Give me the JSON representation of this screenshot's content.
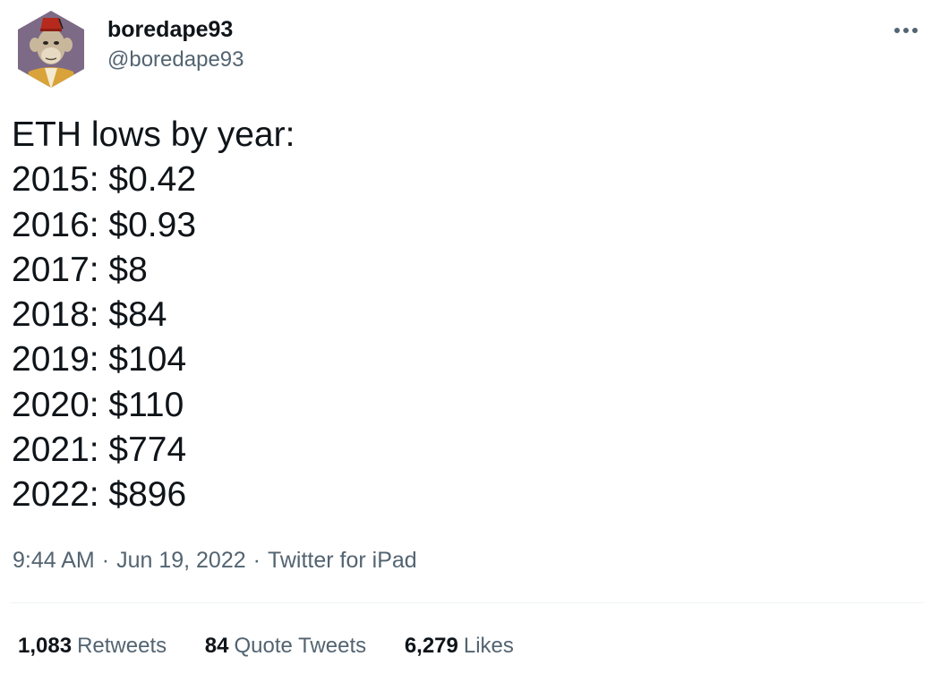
{
  "author": {
    "display_name": "boredape93",
    "handle": "@boredape93"
  },
  "tweet": {
    "lines": [
      "ETH lows by year:",
      "2015: $0.42",
      "2016: $0.93",
      "2017: $8",
      "2018: $84",
      "2019: $104",
      "2020: $110",
      "2021: $774",
      "2022: $896"
    ]
  },
  "meta": {
    "time": "9:44 AM",
    "date": "Jun 19, 2022",
    "separator": "·",
    "source": "Twitter for iPad"
  },
  "stats": {
    "retweets_count": "1,083",
    "retweets_label": "Retweets",
    "quotes_count": "84",
    "quotes_label": "Quote Tweets",
    "likes_count": "6,279",
    "likes_label": "Likes"
  },
  "colors": {
    "text_primary": "#0f1419",
    "text_secondary": "#536471",
    "divider": "#eff3f4",
    "avatar_background": "#7d6a86",
    "fez_red": "#b52a1c",
    "robe_gold": "#d9a33a"
  },
  "icons": {
    "more": "more-horizontal-icon",
    "avatar": "bored-ape-avatar"
  }
}
